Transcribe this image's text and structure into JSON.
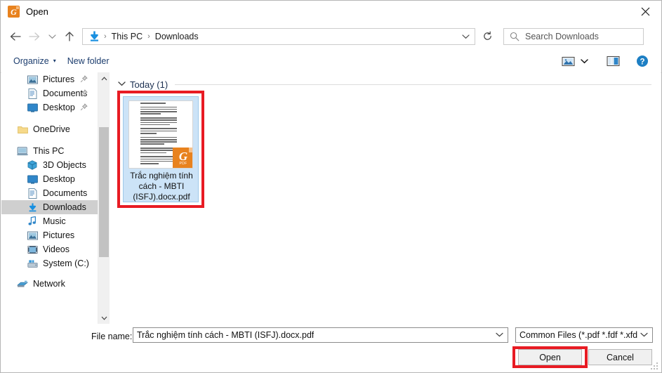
{
  "window": {
    "title": "Open",
    "app_icon": "gaaiho-pdf-icon",
    "app_icon_letter": "G",
    "app_icon_color": "#e8821e",
    "close_label": "×"
  },
  "nav": {
    "back": "back-arrow",
    "forward": "forward-arrow",
    "recent": "recent-locations-chevron",
    "up": "up-arrow",
    "breadcrumb": {
      "location_icon": "downloads-arrow-icon",
      "items": [
        "This PC",
        "Downloads"
      ],
      "separator": "›"
    },
    "address_dropdown": "chevron-down-icon",
    "refresh": "refresh-icon"
  },
  "search": {
    "icon": "search-icon",
    "placeholder": "Search Downloads"
  },
  "toolbar": {
    "organize_label": "Organize",
    "organize_caret": "▾",
    "new_folder_label": "New folder",
    "view_icon": "change-view-icon",
    "view_caret": "▾",
    "preview_pane_icon": "preview-pane-icon",
    "help_icon": "help-icon"
  },
  "sidebar": {
    "items": [
      {
        "label": "Pictures",
        "icon": "pictures-icon",
        "indent": 1,
        "pinned": true,
        "selected": false
      },
      {
        "label": "Documents",
        "icon": "documents-icon",
        "indent": 1,
        "pinned": true,
        "selected": false
      },
      {
        "label": "Desktop",
        "icon": "desktop-icon",
        "indent": 1,
        "pinned": true,
        "selected": false
      },
      {
        "label": "OneDrive",
        "icon": "onedrive-folder-icon",
        "indent": 0,
        "pinned": false,
        "selected": false
      },
      {
        "label": "This PC",
        "icon": "this-pc-icon",
        "indent": 0,
        "pinned": false,
        "selected": false
      },
      {
        "label": "3D Objects",
        "icon": "3d-objects-icon",
        "indent": 1,
        "pinned": false,
        "selected": false
      },
      {
        "label": "Desktop",
        "icon": "desktop-icon",
        "indent": 1,
        "pinned": false,
        "selected": false
      },
      {
        "label": "Documents",
        "icon": "documents-icon",
        "indent": 1,
        "pinned": false,
        "selected": false
      },
      {
        "label": "Downloads",
        "icon": "downloads-icon",
        "indent": 1,
        "pinned": false,
        "selected": true
      },
      {
        "label": "Music",
        "icon": "music-icon",
        "indent": 1,
        "pinned": false,
        "selected": false
      },
      {
        "label": "Pictures",
        "icon": "pictures-icon",
        "indent": 1,
        "pinned": false,
        "selected": false
      },
      {
        "label": "Videos",
        "icon": "videos-icon",
        "indent": 1,
        "pinned": false,
        "selected": false
      },
      {
        "label": "System (C:)",
        "icon": "drive-icon",
        "indent": 1,
        "pinned": false,
        "selected": false
      },
      {
        "label": "Network",
        "icon": "network-icon",
        "indent": 0,
        "pinned": false,
        "selected": false
      }
    ],
    "scroll_up": "∧",
    "scroll_down": "∨"
  },
  "files": {
    "group_header": "Today (1)",
    "group_chevron": "⌄",
    "item": {
      "name": "Trắc nghiệm tính cách - MBTI (ISFJ).docx.pdf",
      "badge_letter": "G",
      "badge_text": "PDF",
      "selected": true
    }
  },
  "bottom": {
    "filename_label": "File name:",
    "filename_value": "Trắc nghiệm tính cách - MBTI (ISFJ).docx.pdf",
    "filename_caret": "⌄",
    "filetype_value": "Common Files (*.pdf *.fdf *.xfd",
    "filetype_caret": "⌄",
    "open_label": "Open",
    "cancel_label": "Cancel"
  },
  "annotations": {
    "highlight_color": "#e81b23",
    "file_highlight": "red-rectangle-around-file",
    "open_highlight": "red-rectangle-around-open-button"
  }
}
